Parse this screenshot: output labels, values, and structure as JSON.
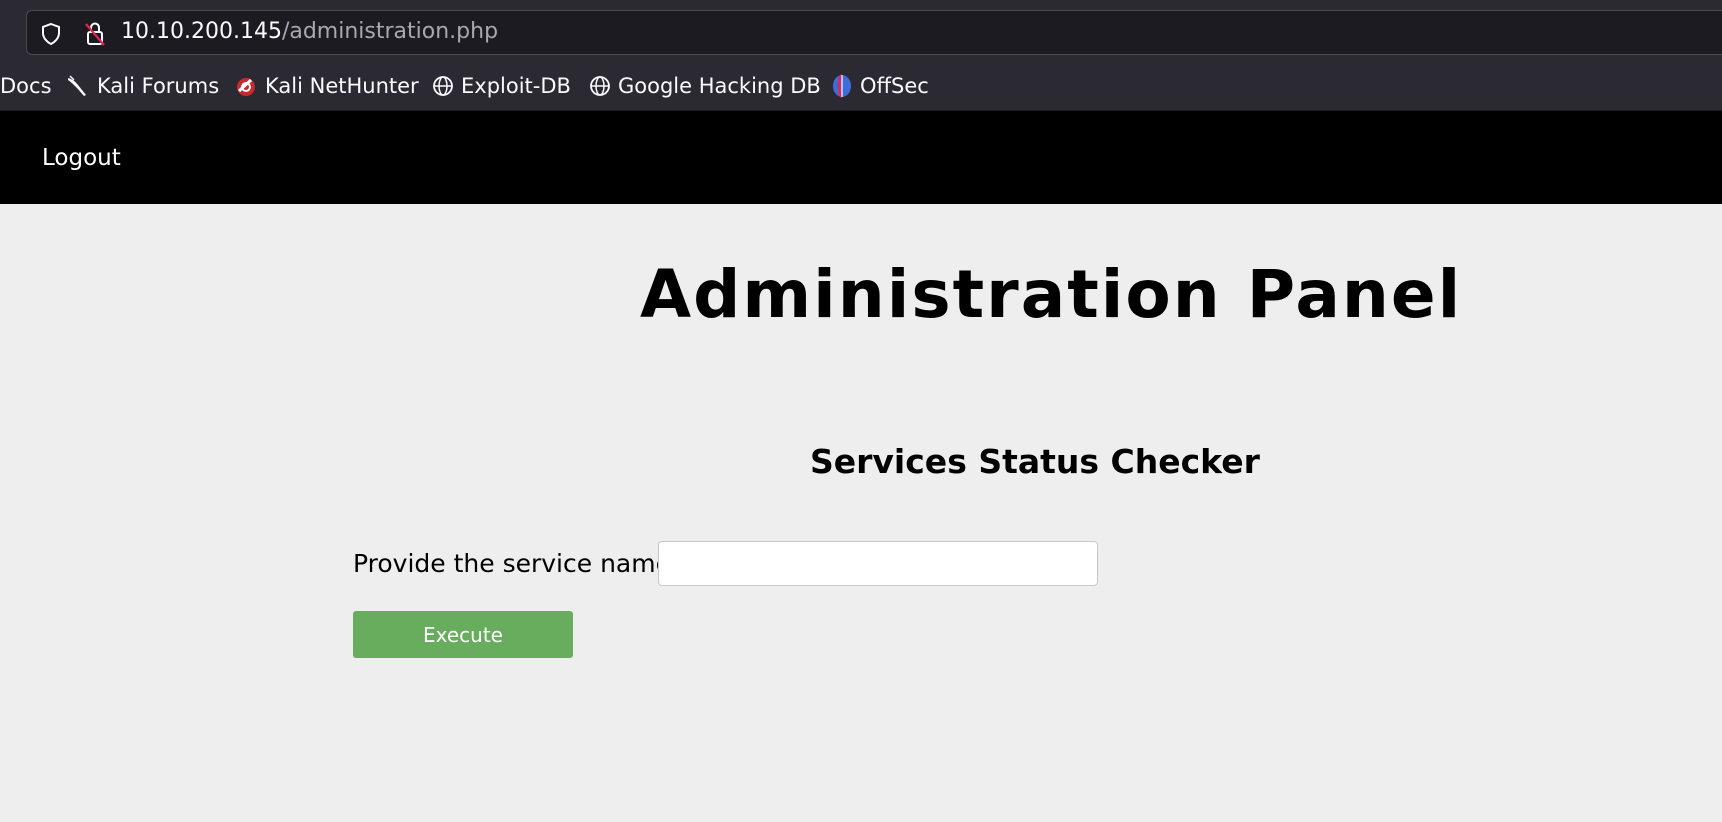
{
  "browser": {
    "url_host": "10.10.200.145",
    "url_path": "/administration.php",
    "bookmarks": [
      {
        "label": "Docs",
        "icon": "none"
      },
      {
        "label": "Kali Forums",
        "icon": "kali-dragon-icon"
      },
      {
        "label": "Kali NetHunter",
        "icon": "nethunter-icon"
      },
      {
        "label": "Exploit-DB",
        "icon": "globe-icon"
      },
      {
        "label": "Google Hacking DB",
        "icon": "globe-icon"
      },
      {
        "label": "OffSec",
        "icon": "offsec-icon"
      }
    ]
  },
  "nav": {
    "logout_label": "Logout"
  },
  "main": {
    "title": "Administration Panel",
    "section_title": "Services Status Checker",
    "service_label": "Provide the service name :",
    "service_value": "",
    "execute_label": "Execute"
  },
  "colors": {
    "nav_background": "#000000",
    "page_background": "#eeeeee",
    "button_green": "#68ad5e"
  }
}
